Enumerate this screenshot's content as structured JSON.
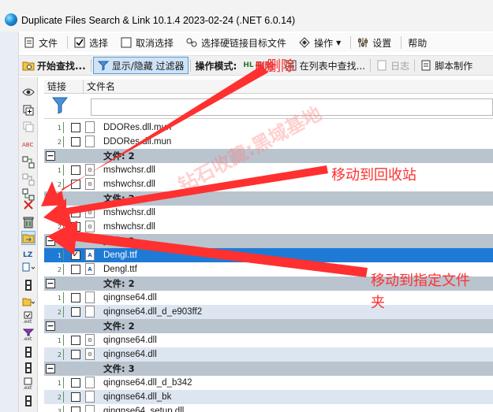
{
  "window": {
    "title": "Duplicate Files Search & Link 10.1.4 2023-02-24 (.NET 6.0.14)"
  },
  "menu": {
    "file": "文件",
    "select": "选择",
    "deselect": "取消选择",
    "select_hardlink_target": "选择硬链接目标文件",
    "operation": "操作",
    "settings": "设置",
    "help": "帮助"
  },
  "toolbar": {
    "start_search": "开始查找...",
    "toggle_filter": "显示/隐藏 过滤器",
    "op_mode_label": "操作模式:",
    "hl_badge": "HL",
    "op_mode_value": "删除",
    "find_in_list": "在列表中查找...",
    "log": "日志",
    "script": "脚本制作"
  },
  "grid": {
    "col_link": "链接",
    "col_filename": "文件名"
  },
  "rows": [
    {
      "type": "file",
      "num": "1",
      "checked": false,
      "icon": "doc",
      "name": "DDORes.dll.mun",
      "alt": false,
      "selected": false
    },
    {
      "type": "file",
      "num": "2",
      "checked": false,
      "icon": "doc",
      "name": "DDORes.dll.mun",
      "alt": false,
      "selected": false
    },
    {
      "type": "group",
      "label": "文件: 2"
    },
    {
      "type": "file",
      "num": "1",
      "checked": false,
      "icon": "dll",
      "name": "mshwchsr.dll",
      "alt": false,
      "selected": false
    },
    {
      "type": "file",
      "num": "2",
      "checked": false,
      "icon": "dll",
      "name": "mshwchsr.dll",
      "alt": false,
      "selected": false
    },
    {
      "type": "group",
      "label": "文件: 2"
    },
    {
      "type": "file",
      "num": "1",
      "checked": false,
      "icon": "dll",
      "name": "mshwchsr.dll",
      "alt": false,
      "selected": false
    },
    {
      "type": "file",
      "num": "2",
      "checked": false,
      "icon": "dll",
      "name": "mshwchsr.dll",
      "alt": false,
      "selected": false
    },
    {
      "type": "group",
      "label": "文件: 2"
    },
    {
      "type": "file",
      "num": "1",
      "checked": true,
      "icon": "ttf",
      "name": "Dengl.ttf",
      "alt": false,
      "selected": true
    },
    {
      "type": "file",
      "num": "2",
      "checked": false,
      "icon": "ttf",
      "name": "Dengl.ttf",
      "alt": false,
      "selected": false
    },
    {
      "type": "group",
      "label": "文件: 2"
    },
    {
      "type": "file",
      "num": "1",
      "checked": false,
      "icon": "doc",
      "name": "qingnse64.dll",
      "alt": false,
      "selected": false
    },
    {
      "type": "file",
      "num": "2",
      "checked": false,
      "icon": "doc",
      "name": "qingnse64.dll_d_e903ff2",
      "alt": true,
      "selected": false
    },
    {
      "type": "group",
      "label": "文件: 2"
    },
    {
      "type": "file",
      "num": "1",
      "checked": false,
      "icon": "dll",
      "name": "qingnse64.dll",
      "alt": false,
      "selected": false
    },
    {
      "type": "file",
      "num": "2",
      "checked": false,
      "icon": "dll",
      "name": "qingnse64.dll",
      "alt": true,
      "selected": false
    },
    {
      "type": "group",
      "label": "文件: 3"
    },
    {
      "type": "file",
      "num": "1",
      "checked": false,
      "icon": "doc",
      "name": "qingnse64.dll_d_b342",
      "alt": false,
      "selected": false
    },
    {
      "type": "file",
      "num": "2",
      "checked": false,
      "icon": "doc",
      "name": "qingnse64.dll_bk",
      "alt": true,
      "selected": false
    },
    {
      "type": "file",
      "num": "3",
      "checked": false,
      "icon": "doc",
      "name": "qingnse64_setup.dll",
      "alt": false,
      "selected": false
    }
  ],
  "annotations": {
    "delete": "删除",
    "recycle": "移动到回收站",
    "move_folder_1": "移动到指定文件",
    "move_folder_2": "夹",
    "watermark": "钻石收藏:黑域基地"
  },
  "colors": {
    "selection": "#1f7ad6",
    "group_bg": "#b9c4cf",
    "annotation": "#ff3030"
  }
}
